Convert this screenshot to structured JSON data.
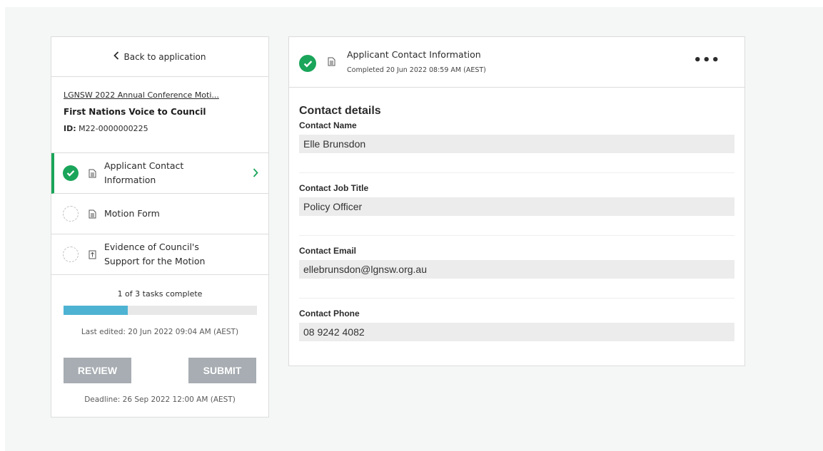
{
  "sidebar": {
    "back_label": "Back to application",
    "application_link": "LGNSW 2022 Annual Conference Moti...",
    "application_title": "First Nations Voice to Council",
    "id_label": "ID:",
    "id_value": "M22-0000000225",
    "tasks": [
      {
        "label": "Applicant Contact Information",
        "status": "complete",
        "icon": "document-icon",
        "active": true
      },
      {
        "label": "Motion Form",
        "status": "incomplete",
        "icon": "document-icon",
        "active": false
      },
      {
        "label": "Evidence of Council's Support for the Motion",
        "status": "incomplete",
        "icon": "upload-icon",
        "active": false
      }
    ],
    "progress_text": "1 of 3 tasks complete",
    "progress_fraction": 0.333,
    "last_edited": "Last edited: 20 Jun 2022 09:04 AM (AEST)",
    "review_label": "REVIEW",
    "submit_label": "SUBMIT",
    "deadline": "Deadline: 26 Sep 2022 12:00 AM (AEST)"
  },
  "main": {
    "title": "Applicant Contact Information",
    "subtitle": "Completed 20 Jun 2022 08:59 AM (AEST)",
    "more_label": "•••",
    "section_title": "Contact details",
    "fields": [
      {
        "label": "Contact Name",
        "value": "Elle Brunsdon"
      },
      {
        "label": "Contact Job Title",
        "value": "Policy Officer"
      },
      {
        "label": "Contact Email",
        "value": "ellebrunsdon@lgnsw.org.au"
      },
      {
        "label": "Contact Phone",
        "value": "08 9242 4082"
      }
    ]
  },
  "colors": {
    "success": "#1aa55a",
    "progress": "#4eb3d3",
    "button_disabled": "#a7adb2"
  }
}
